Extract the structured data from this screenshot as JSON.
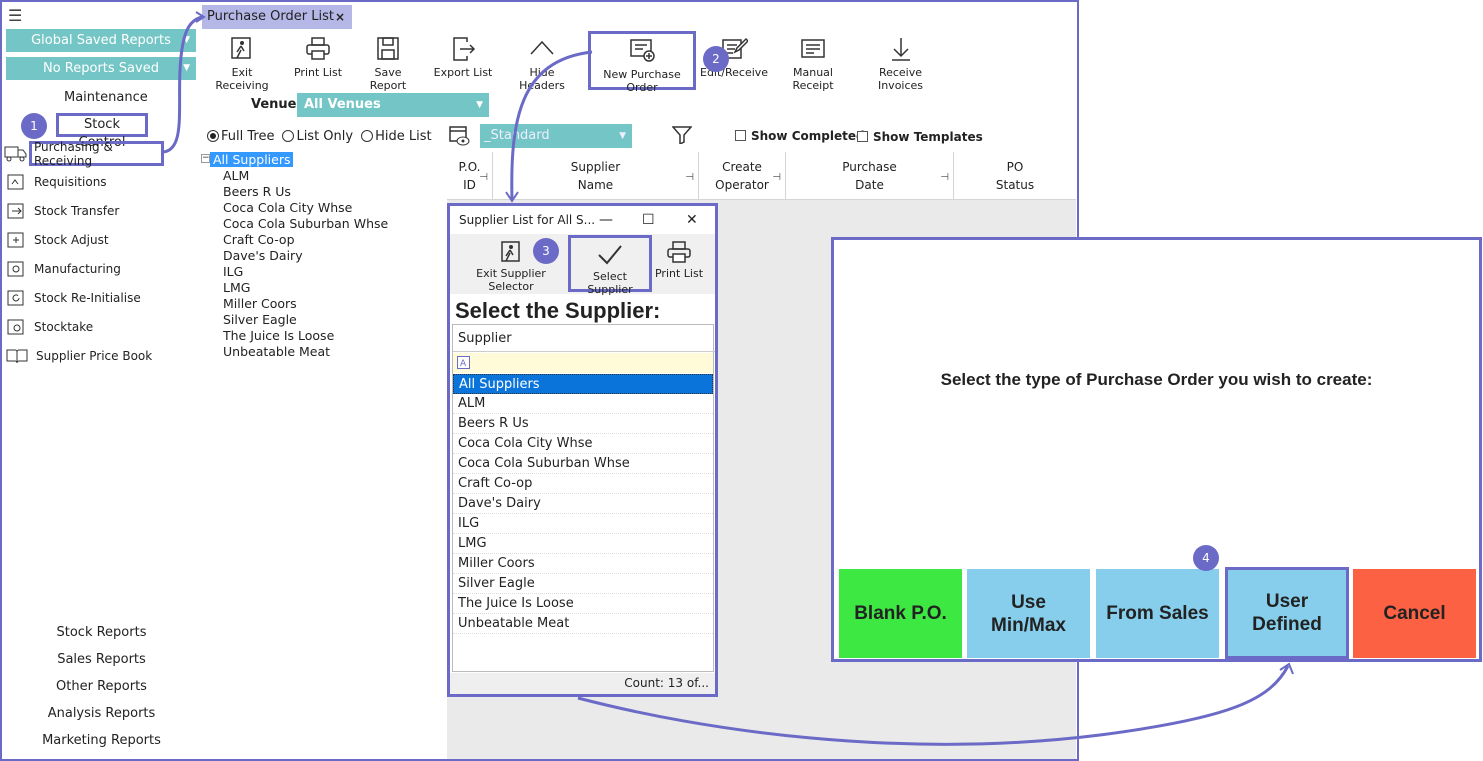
{
  "sidebar": {
    "global_reports": "Global Saved Reports",
    "no_reports": "No Reports Saved",
    "maintenance": "Maintenance",
    "stock_control": "Stock Control",
    "items": [
      {
        "label": "Purchasing & Receiving",
        "icon": "truck-icon"
      },
      {
        "label": "Requisitions",
        "icon": "requisition-icon"
      },
      {
        "label": "Stock Transfer",
        "icon": "transfer-icon"
      },
      {
        "label": "Stock Adjust",
        "icon": "adjust-icon"
      },
      {
        "label": "Manufacturing",
        "icon": "manufacturing-icon"
      },
      {
        "label": "Stock Re-Initialise",
        "icon": "reinitialise-icon"
      },
      {
        "label": "Stocktake",
        "icon": "stocktake-icon"
      },
      {
        "label": "Supplier Price Book",
        "icon": "book-icon"
      }
    ],
    "reports": [
      "Stock Reports",
      "Sales Reports",
      "Other Reports",
      "Analysis Reports",
      "Marketing Reports"
    ]
  },
  "tab": {
    "label": "Purchase Order List",
    "close": "×"
  },
  "toolbar": {
    "exit": "Exit Receiving",
    "print": "Print List",
    "save": "Save Report",
    "export": "Export List",
    "hide": "Hide Headers",
    "new_po": "New Purchase Order",
    "edit": "Edit/Receive",
    "manual": "Manual Receipt",
    "invoices": "Receive Invoices"
  },
  "venue": {
    "label": "Venue:",
    "value": "All Venues"
  },
  "view": {
    "full_tree": "Full Tree",
    "list_only": "List Only",
    "hide_list": "Hide List",
    "selected": "Full Tree"
  },
  "layout_select": "_Standard",
  "filters": {
    "show_completed": "Show Completed",
    "show_templates": "Show Templates"
  },
  "tree": {
    "root": "All Suppliers",
    "children": [
      "ALM",
      "Beers R Us",
      "Coca Cola City Whse",
      "Coca Cola Suburban Whse",
      "Craft Co-op",
      "Dave's Dairy",
      "ILG",
      "LMG",
      "Miller Coors",
      "Silver Eagle",
      "The Juice Is Loose",
      "Unbeatable Meat"
    ]
  },
  "grid": {
    "columns": [
      "P.O.\nID",
      "Supplier\nName",
      "Create\nOperator",
      "Purchase\nDate",
      "PO\nStatus"
    ]
  },
  "dialog": {
    "title": "Supplier List for All S...",
    "exit": "Exit Supplier Selector",
    "select": "Select Supplier",
    "print": "Print List",
    "heading": "Select the Supplier:",
    "column": "Supplier",
    "rows": [
      "All Suppliers",
      "ALM",
      "Beers R Us",
      "Coca Cola City Whse",
      "Coca Cola Suburban Whse",
      "Craft Co-op",
      "Dave's Dairy",
      "ILG",
      "LMG",
      "Miller Coors",
      "Silver Eagle",
      "The Juice Is Loose",
      "Unbeatable Meat"
    ],
    "count": "Count:  13  of..."
  },
  "po_panel": {
    "prompt": "Select the type of Purchase Order you wish to create:",
    "buttons": [
      {
        "label": "Blank P.O.",
        "color": "#3ee843"
      },
      {
        "label": "Use\nMin/Max",
        "color": "#86ceeb"
      },
      {
        "label": "From Sales",
        "color": "#86ceeb"
      },
      {
        "label": "User\nDefined",
        "color": "#86ceeb"
      },
      {
        "label": "Cancel",
        "color": "#fd6143"
      }
    ]
  },
  "badges": [
    "1",
    "2",
    "3",
    "4"
  ],
  "colors": {
    "accent": "#6b6bc7",
    "teal": "#74c6c6",
    "selection": "#3399ff"
  }
}
